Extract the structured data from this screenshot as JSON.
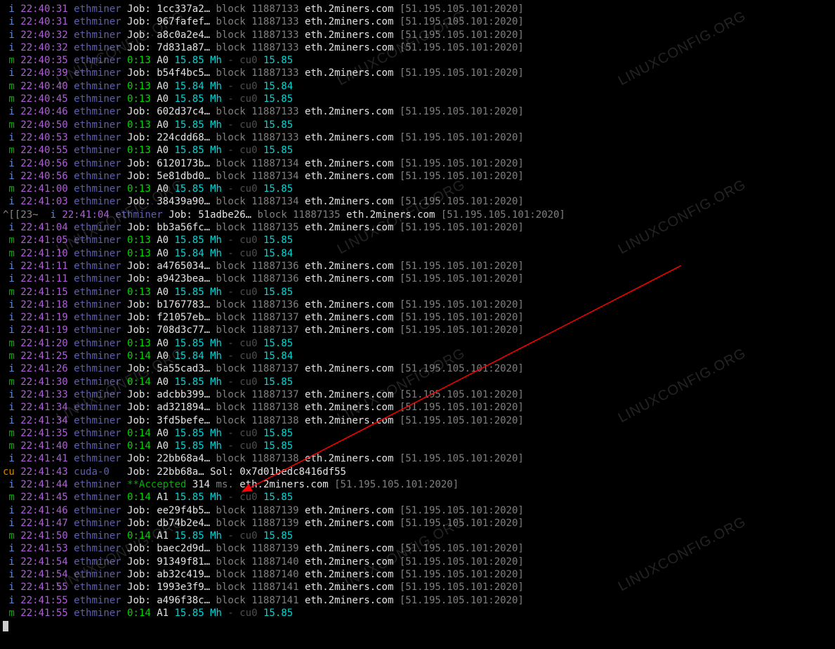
{
  "pool": "eth.2miners.com",
  "pool_addr": "[51.195.105.101:2020]",
  "lines": [
    {
      "t": "job",
      "p": "i",
      "ts": "22:40:31",
      "src": "ethminer",
      "hash": "1cc337a2…",
      "block": "11887133"
    },
    {
      "t": "job",
      "p": "i",
      "ts": "22:40:31",
      "src": "ethminer",
      "hash": "967fafef…",
      "block": "11887133"
    },
    {
      "t": "job",
      "p": "i",
      "ts": "22:40:32",
      "src": "ethminer",
      "hash": "a8c0a2e4…",
      "block": "11887133"
    },
    {
      "t": "job",
      "p": "i",
      "ts": "22:40:32",
      "src": "ethminer",
      "hash": "7d831a87…",
      "block": "11887133"
    },
    {
      "t": "rate",
      "p": "m",
      "ts": "22:40:35",
      "src": "ethminer",
      "el": "0:13",
      "a": "A0",
      "rate": "15.85",
      "cu": "15.85"
    },
    {
      "t": "job",
      "p": "i",
      "ts": "22:40:39",
      "src": "ethminer",
      "hash": "b54f4bc5…",
      "block": "11887133"
    },
    {
      "t": "rate",
      "p": "m",
      "ts": "22:40:40",
      "src": "ethminer",
      "el": "0:13",
      "a": "A0",
      "rate": "15.84",
      "cu": "15.84"
    },
    {
      "t": "rate",
      "p": "m",
      "ts": "22:40:45",
      "src": "ethminer",
      "el": "0:13",
      "a": "A0",
      "rate": "15.85",
      "cu": "15.85"
    },
    {
      "t": "job",
      "p": "i",
      "ts": "22:40:46",
      "src": "ethminer",
      "hash": "602d37c4…",
      "block": "11887133"
    },
    {
      "t": "rate",
      "p": "m",
      "ts": "22:40:50",
      "src": "ethminer",
      "el": "0:13",
      "a": "A0",
      "rate": "15.85",
      "cu": "15.85"
    },
    {
      "t": "job",
      "p": "i",
      "ts": "22:40:53",
      "src": "ethminer",
      "hash": "224cdd68…",
      "block": "11887133"
    },
    {
      "t": "rate",
      "p": "m",
      "ts": "22:40:55",
      "src": "ethminer",
      "el": "0:13",
      "a": "A0",
      "rate": "15.85",
      "cu": "15.85"
    },
    {
      "t": "job",
      "p": "i",
      "ts": "22:40:56",
      "src": "ethminer",
      "hash": "6120173b…",
      "block": "11887134"
    },
    {
      "t": "job",
      "p": "i",
      "ts": "22:40:56",
      "src": "ethminer",
      "hash": "5e81dbd0…",
      "block": "11887134"
    },
    {
      "t": "rate",
      "p": "m",
      "ts": "22:41:00",
      "src": "ethminer",
      "el": "0:13",
      "a": "A0",
      "rate": "15.85",
      "cu": "15.85"
    },
    {
      "t": "job",
      "p": "i",
      "ts": "22:41:03",
      "src": "ethminer",
      "hash": "38439a90…",
      "block": "11887134"
    },
    {
      "t": "esc_job",
      "p": "i",
      "ts": "22:41:04",
      "src": "ethminer",
      "esc": "^[[23~ ",
      "hash": "51adbe26…",
      "block": "11887135"
    },
    {
      "t": "job",
      "p": "i",
      "ts": "22:41:04",
      "src": "ethminer",
      "hash": "bb3a56fc…",
      "block": "11887135"
    },
    {
      "t": "rate",
      "p": "m",
      "ts": "22:41:05",
      "src": "ethminer",
      "el": "0:13",
      "a": "A0",
      "rate": "15.85",
      "cu": "15.85"
    },
    {
      "t": "rate",
      "p": "m",
      "ts": "22:41:10",
      "src": "ethminer",
      "el": "0:13",
      "a": "A0",
      "rate": "15.84",
      "cu": "15.84"
    },
    {
      "t": "job",
      "p": "i",
      "ts": "22:41:11",
      "src": "ethminer",
      "hash": "a4765034…",
      "block": "11887136"
    },
    {
      "t": "job",
      "p": "i",
      "ts": "22:41:11",
      "src": "ethminer",
      "hash": "a9423bea…",
      "block": "11887136"
    },
    {
      "t": "rate",
      "p": "m",
      "ts": "22:41:15",
      "src": "ethminer",
      "el": "0:13",
      "a": "A0",
      "rate": "15.85",
      "cu": "15.85"
    },
    {
      "t": "job",
      "p": "i",
      "ts": "22:41:18",
      "src": "ethminer",
      "hash": "b1767783…",
      "block": "11887136"
    },
    {
      "t": "job",
      "p": "i",
      "ts": "22:41:19",
      "src": "ethminer",
      "hash": "f21057eb…",
      "block": "11887137"
    },
    {
      "t": "job",
      "p": "i",
      "ts": "22:41:19",
      "src": "ethminer",
      "hash": "708d3c77…",
      "block": "11887137"
    },
    {
      "t": "rate",
      "p": "m",
      "ts": "22:41:20",
      "src": "ethminer",
      "el": "0:13",
      "a": "A0",
      "rate": "15.85",
      "cu": "15.85"
    },
    {
      "t": "rate",
      "p": "m",
      "ts": "22:41:25",
      "src": "ethminer",
      "el": "0:14",
      "a": "A0",
      "rate": "15.84",
      "cu": "15.84"
    },
    {
      "t": "job",
      "p": "i",
      "ts": "22:41:26",
      "src": "ethminer",
      "hash": "5a55cad3…",
      "block": "11887137"
    },
    {
      "t": "rate",
      "p": "m",
      "ts": "22:41:30",
      "src": "ethminer",
      "el": "0:14",
      "a": "A0",
      "rate": "15.85",
      "cu": "15.85"
    },
    {
      "t": "job",
      "p": "i",
      "ts": "22:41:33",
      "src": "ethminer",
      "hash": "adcbb399…",
      "block": "11887137"
    },
    {
      "t": "job",
      "p": "i",
      "ts": "22:41:34",
      "src": "ethminer",
      "hash": "ad321894…",
      "block": "11887138"
    },
    {
      "t": "job",
      "p": "i",
      "ts": "22:41:34",
      "src": "ethminer",
      "hash": "3fd5befe…",
      "block": "11887138"
    },
    {
      "t": "rate",
      "p": "m",
      "ts": "22:41:35",
      "src": "ethminer",
      "el": "0:14",
      "a": "A0",
      "rate": "15.85",
      "cu": "15.85"
    },
    {
      "t": "rate",
      "p": "m",
      "ts": "22:41:40",
      "src": "ethminer",
      "el": "0:14",
      "a": "A0",
      "rate": "15.85",
      "cu": "15.85"
    },
    {
      "t": "job",
      "p": "i",
      "ts": "22:41:41",
      "src": "ethminer",
      "hash": "22bb68a4…",
      "block": "11887138"
    },
    {
      "t": "sol",
      "p": "cu",
      "ts": "22:41:43",
      "src": "cuda-0",
      "hash": "22bb68a…",
      "sol": "0x7d01bedc8416df55"
    },
    {
      "t": "acc",
      "p": "i",
      "ts": "22:41:44",
      "src": "ethminer",
      "ms": "314"
    },
    {
      "t": "rate",
      "p": "m",
      "ts": "22:41:45",
      "src": "ethminer",
      "el": "0:14",
      "a": "A1",
      "rate": "15.85",
      "cu": "15.85"
    },
    {
      "t": "job",
      "p": "i",
      "ts": "22:41:46",
      "src": "ethminer",
      "hash": "ee29f4b5…",
      "block": "11887139"
    },
    {
      "t": "job",
      "p": "i",
      "ts": "22:41:47",
      "src": "ethminer",
      "hash": "db74b2e4…",
      "block": "11887139"
    },
    {
      "t": "rate",
      "p": "m",
      "ts": "22:41:50",
      "src": "ethminer",
      "el": "0:14",
      "a": "A1",
      "rate": "15.85",
      "cu": "15.85"
    },
    {
      "t": "job",
      "p": "i",
      "ts": "22:41:53",
      "src": "ethminer",
      "hash": "baec2d9d…",
      "block": "11887139"
    },
    {
      "t": "job",
      "p": "i",
      "ts": "22:41:54",
      "src": "ethminer",
      "hash": "91349f81…",
      "block": "11887140"
    },
    {
      "t": "job",
      "p": "i",
      "ts": "22:41:54",
      "src": "ethminer",
      "hash": "ab32c419…",
      "block": "11887140"
    },
    {
      "t": "job",
      "p": "i",
      "ts": "22:41:55",
      "src": "ethminer",
      "hash": "1993e3f9…",
      "block": "11887141"
    },
    {
      "t": "job",
      "p": "i",
      "ts": "22:41:55",
      "src": "ethminer",
      "hash": "a496f38c…",
      "block": "11887141"
    },
    {
      "t": "rate",
      "p": "m",
      "ts": "22:41:55",
      "src": "ethminer",
      "el": "0:14",
      "a": "A1",
      "rate": "15.85",
      "cu": "15.85"
    }
  ],
  "labels": {
    "job": "Job:",
    "block": "block",
    "mh": "Mh",
    "cu0": "cu0",
    "sol": "Sol:",
    "accepted": "**Accepted",
    "ms": "ms."
  },
  "watermark": "LINUXCONFIG.ORG"
}
